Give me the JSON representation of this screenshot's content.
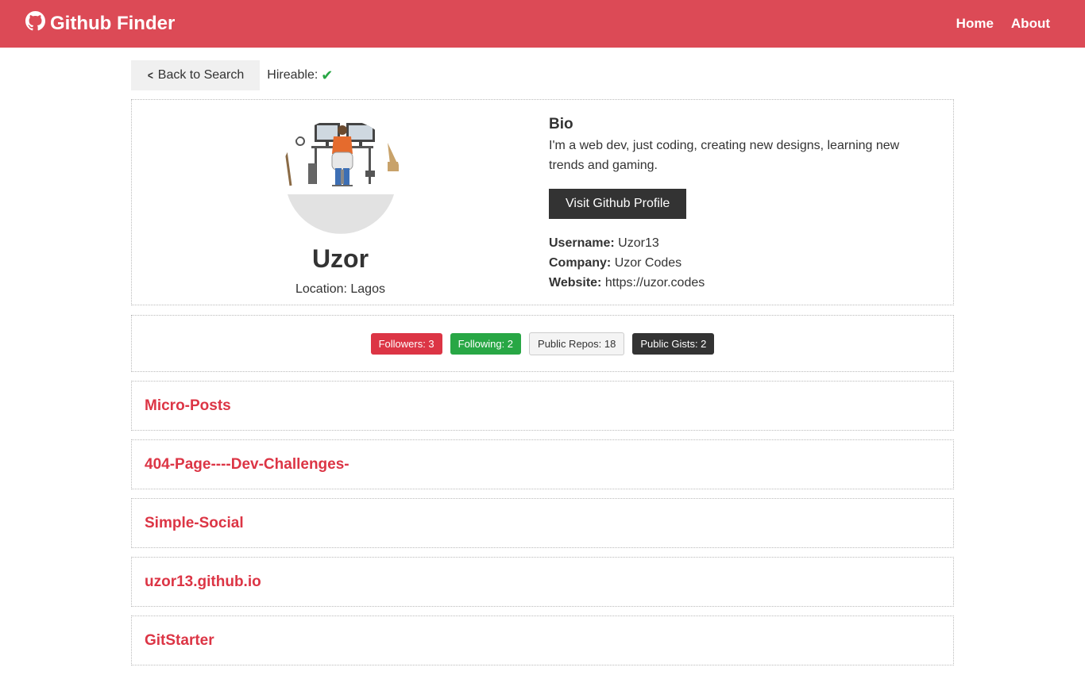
{
  "nav": {
    "brand": "Github Finder",
    "links": [
      "Home",
      "About"
    ]
  },
  "top": {
    "back_label": "Back to Search",
    "hireable_label": "Hireable:"
  },
  "profile": {
    "name": "Uzor",
    "location": "Location: Lagos",
    "bio_title": "Bio",
    "bio": "I'm a web dev, just coding, creating new designs, learning new trends and gaming.",
    "visit_label": "Visit Github Profile",
    "username_label": "Username:",
    "username": "Uzor13",
    "company_label": "Company:",
    "company": "Uzor Codes",
    "website_label": "Website:",
    "website": "https://uzor.codes"
  },
  "stats": {
    "followers": "Followers: 3",
    "following": "Following: 2",
    "repos": "Public Repos: 18",
    "gists": "Public Gists: 2"
  },
  "repos": [
    "Micro-Posts",
    "404-Page----Dev-Challenges-",
    "Simple-Social",
    "uzor13.github.io",
    "GitStarter"
  ],
  "colors": {
    "navbar": "#dc4a56",
    "accent": "#dc3545",
    "success": "#28a745",
    "dark": "#333333"
  },
  "icons": {
    "brand": "github-icon",
    "back": "chevron-left-icon",
    "hireable": "check-icon"
  }
}
